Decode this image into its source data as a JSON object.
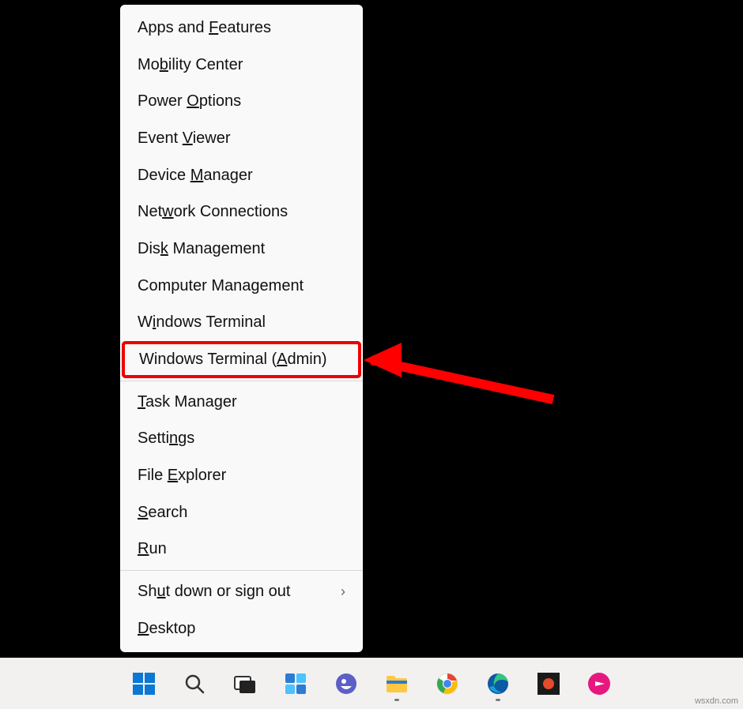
{
  "menu": {
    "sections": [
      [
        {
          "before": "Apps and ",
          "u": "F",
          "after": "eatures"
        },
        {
          "before": "Mo",
          "u": "b",
          "after": "ility Center"
        },
        {
          "before": "Power ",
          "u": "O",
          "after": "ptions"
        },
        {
          "before": "Event ",
          "u": "V",
          "after": "iewer"
        },
        {
          "before": "Device ",
          "u": "M",
          "after": "anager"
        },
        {
          "before": "Net",
          "u": "w",
          "after": "ork Connections"
        },
        {
          "before": "Dis",
          "u": "k",
          "after": " Management"
        },
        {
          "before": "Computer Mana",
          "u": "g",
          "after": "ement"
        },
        {
          "before": "W",
          "u": "i",
          "after": "ndows Terminal"
        },
        {
          "before": "Windows Terminal (",
          "u": "A",
          "after": "dmin)",
          "highlight": true
        }
      ],
      [
        {
          "before": "",
          "u": "T",
          "after": "ask Manager"
        },
        {
          "before": "Setti",
          "u": "n",
          "after": "gs"
        },
        {
          "before": "File ",
          "u": "E",
          "after": "xplorer"
        },
        {
          "before": "",
          "u": "S",
          "after": "earch"
        },
        {
          "before": "",
          "u": "R",
          "after": "un"
        }
      ],
      [
        {
          "before": "Sh",
          "u": "u",
          "after": "t down or sign out",
          "submenu": true
        },
        {
          "before": "",
          "u": "D",
          "after": "esktop"
        }
      ]
    ]
  },
  "taskbar": {
    "buttons": [
      {
        "name": "start-button"
      },
      {
        "name": "search-button"
      },
      {
        "name": "task-view-button"
      },
      {
        "name": "widgets-button"
      },
      {
        "name": "chat-icon",
        "running": false
      },
      {
        "name": "file-explorer-icon",
        "running": true
      },
      {
        "name": "chrome-icon",
        "running": false
      },
      {
        "name": "edge-icon",
        "running": true
      },
      {
        "name": "app-icon-1",
        "running": false
      },
      {
        "name": "app-icon-2",
        "running": false
      }
    ]
  },
  "watermark": "wsxdn.com"
}
